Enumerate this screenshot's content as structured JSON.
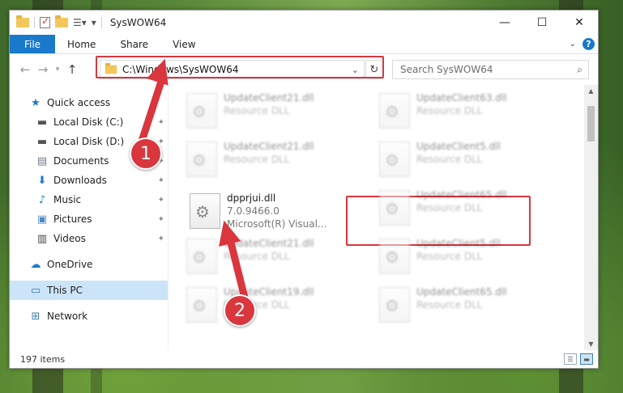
{
  "window": {
    "title": "SysWOW64",
    "controls": {
      "minimize": "—",
      "maximize": "☐",
      "close": "✕"
    }
  },
  "ribbon": {
    "file": "File",
    "tabs": [
      "Home",
      "Share",
      "View"
    ],
    "help": "?"
  },
  "nav": {
    "back": "←",
    "forward": "→",
    "recent": "▾",
    "up": "↑",
    "address": "C:\\Windows\\SysWOW64",
    "refresh": "↻",
    "search_placeholder": "Search SysWOW64"
  },
  "sidebar": {
    "items": [
      {
        "label": "Quick access",
        "icon": "star-icon",
        "glyph": "★",
        "pinned": false
      },
      {
        "label": "Local Disk (C:)",
        "icon": "drive-icon",
        "glyph": "▬",
        "pinned": true
      },
      {
        "label": "Local Disk (D:)",
        "icon": "drive-icon",
        "glyph": "▬",
        "pinned": true
      },
      {
        "label": "Documents",
        "icon": "documents-icon",
        "glyph": "▤",
        "pinned": true
      },
      {
        "label": "Downloads",
        "icon": "download-icon",
        "glyph": "⬇",
        "pinned": true
      },
      {
        "label": "Music",
        "icon": "music-icon",
        "glyph": "♪",
        "pinned": true
      },
      {
        "label": "Pictures",
        "icon": "pictures-icon",
        "glyph": "▣",
        "pinned": true
      },
      {
        "label": "Videos",
        "icon": "videos-icon",
        "glyph": "▥",
        "pinned": true
      },
      {
        "label": "OneDrive",
        "icon": "cloud-icon",
        "glyph": "☁",
        "pinned": false
      },
      {
        "label": "This PC",
        "icon": "computer-icon",
        "glyph": "▭",
        "pinned": false
      },
      {
        "label": "Network",
        "icon": "network-icon",
        "glyph": "⊞",
        "pinned": false
      }
    ],
    "pin_glyph": "📌"
  },
  "files": {
    "highlighted": {
      "name": "dpprjui.dll",
      "version": "7.0.9466.0",
      "company": "Microsoft(R) Visual..."
    },
    "left_column": [
      {
        "name": "UpdateClient21.dll",
        "type": "Resource DLL"
      },
      {
        "name": "UpdateClient21.dll",
        "type": "Resource DLL"
      },
      {
        "name": "UpdateClient21.dll",
        "type": "Resource DLL"
      },
      {
        "name": "UpdateClient19.dll",
        "type": "Resource DLL"
      }
    ],
    "right_column": [
      {
        "name": "UpdateClient63.dll",
        "type": "Resource DLL"
      },
      {
        "name": "UpdateClient5.dll",
        "type": "Resource DLL"
      },
      {
        "name": "UpdateClient65.dll",
        "type": "Resource DLL"
      },
      {
        "name": "UpdateClient5.dll",
        "type": "Resource DLL"
      },
      {
        "name": "UpdateClient65.dll",
        "type": "Resource DLL"
      }
    ]
  },
  "status": {
    "item_count": "197 items"
  },
  "annotations": {
    "step1": "1",
    "step2": "2",
    "color": "#d9363e"
  },
  "colors": {
    "accent": "#1979ca",
    "selection": "#cce4f7"
  }
}
